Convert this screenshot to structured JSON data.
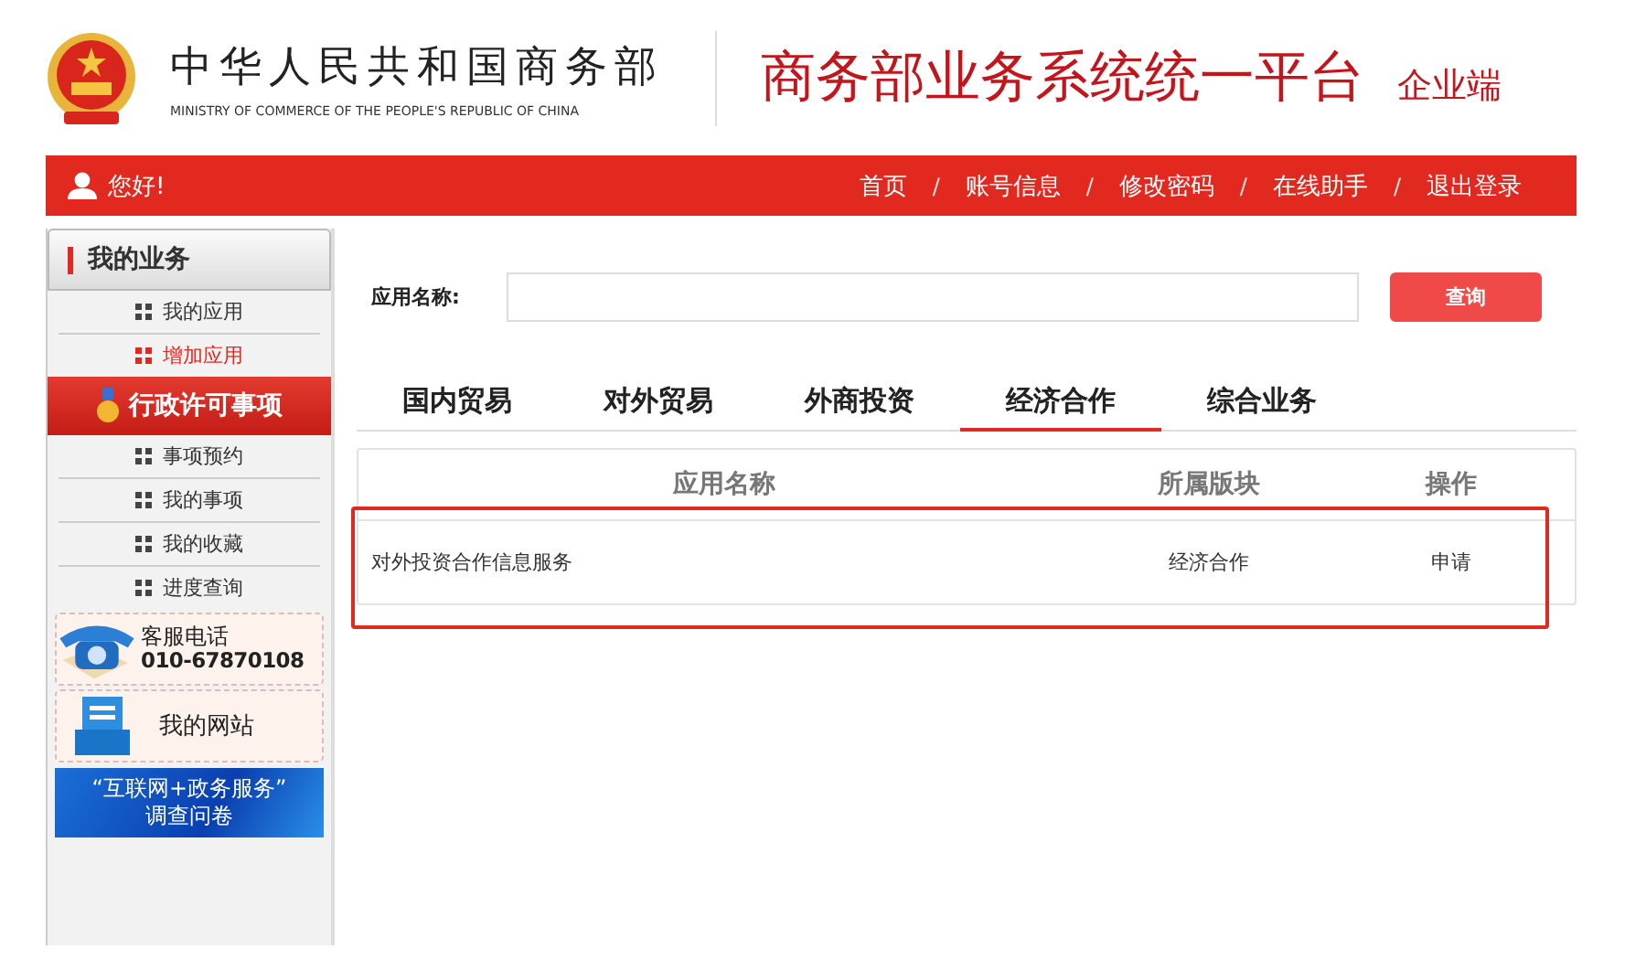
{
  "header": {
    "ministry_name": "中华人民共和国商务部",
    "ministry_name_en": "MINISTRY OF COMMERCE OF THE PEOPLE'S REPUBLIC OF CHINA",
    "platform_title": "商务部业务系统统一平台",
    "platform_subtitle": "企业端"
  },
  "top_bar": {
    "greeting": "您好!",
    "items": [
      {
        "kind": "link",
        "label": "首页"
      },
      {
        "kind": "separator",
        "label": "/"
      },
      {
        "kind": "link",
        "label": "账号信息"
      },
      {
        "kind": "separator",
        "label": "/"
      },
      {
        "kind": "link",
        "label": "修改密码"
      },
      {
        "kind": "separator",
        "label": "/"
      },
      {
        "kind": "link",
        "label": "在线助手"
      },
      {
        "kind": "separator",
        "label": "/"
      },
      {
        "kind": "link",
        "label": "退出登录"
      }
    ]
  },
  "sidebar": {
    "sections": [
      {
        "kind": "plain",
        "title": "我的业务",
        "items": [
          {
            "label": "我的应用",
            "selected": false
          },
          {
            "label": "增加应用",
            "selected": true
          }
        ]
      },
      {
        "kind": "highlight",
        "title": "行政许可事项",
        "items": [
          {
            "label": "事项预约",
            "selected": false
          },
          {
            "label": "我的事项",
            "selected": false
          },
          {
            "label": "我的收藏",
            "selected": false
          },
          {
            "label": "进度查询",
            "selected": false
          }
        ]
      }
    ],
    "hotline": {
      "label": "客服电话",
      "number": "010-67870108"
    },
    "website": {
      "label": "我的网站"
    },
    "survey": {
      "line_1": "“互联网+政务服务”",
      "line_2": "调查问卷"
    }
  },
  "main": {
    "search": {
      "label": "应用名称:",
      "button": "查询"
    },
    "tabs": [
      {
        "label": "国内贸易",
        "selected": false
      },
      {
        "label": "对外贸易",
        "selected": false
      },
      {
        "label": "外商投资",
        "selected": false
      },
      {
        "label": "经济合作",
        "selected": true
      },
      {
        "label": "综合业务",
        "selected": false
      }
    ],
    "table": {
      "columns": [
        "应用名称",
        "所属版块",
        "操作"
      ],
      "rows": [
        {
          "cells": [
            "对外投资合作信息服务",
            "经济合作",
            "申请"
          ],
          "highlighted": true
        }
      ]
    }
  }
}
